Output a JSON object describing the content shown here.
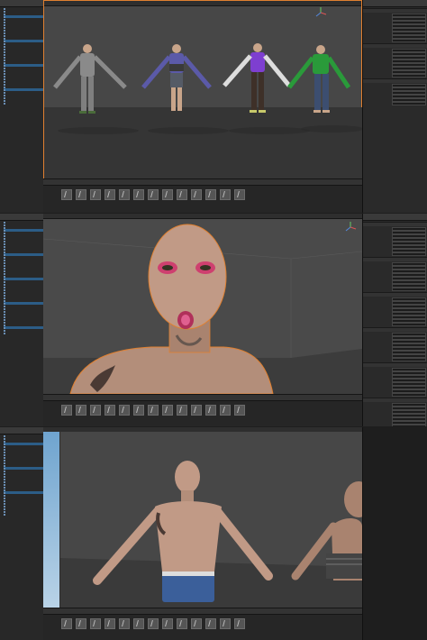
{
  "panels": [
    {
      "name": "top",
      "hierarchy_rows": 36,
      "inspector_rows": 22
    },
    {
      "name": "middle",
      "hierarchy_rows": 42,
      "inspector_rows": 48
    },
    {
      "name": "bottom",
      "hierarchy_rows": 30,
      "inspector_rows": 0
    }
  ],
  "animation_tiles": 13,
  "colors": {
    "editor_bg": "#282828",
    "viewport_bg": "#474747",
    "selection_outline": "#e08030",
    "hierarchy_text": "#8eb0d8",
    "sky_top": "#6fa4cf"
  },
  "characters": [
    {
      "name": "character-grey-hoodie",
      "shirt": "#8a8a8a",
      "pants": "#7f7f7f"
    },
    {
      "name": "character-purple-hoodie",
      "shirt": "#5b5aa8",
      "pants": "#555b66"
    },
    {
      "name": "character-purple-white",
      "shirt": "#7e3fd0",
      "pants": "#3e3028"
    },
    {
      "name": "character-green-hoodie",
      "shirt": "#2a9a3a",
      "pants": "#3c4e70"
    }
  ]
}
